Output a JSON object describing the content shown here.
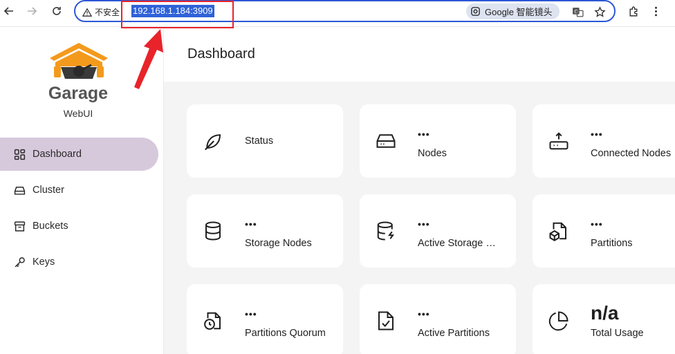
{
  "browser": {
    "security_label": "不安全",
    "url": "192.168.1.184:3909",
    "lens_label": "Google 智能镜头"
  },
  "sidebar": {
    "brand_title": "Garage",
    "brand_subtitle": "WebUI",
    "items": [
      {
        "label": "Dashboard",
        "active": true
      },
      {
        "label": "Cluster",
        "active": false
      },
      {
        "label": "Buckets",
        "active": false
      },
      {
        "label": "Keys",
        "active": false
      }
    ]
  },
  "main": {
    "title": "Dashboard",
    "cards": [
      {
        "label": "Status",
        "value": ""
      },
      {
        "label": "Nodes",
        "value": "•••"
      },
      {
        "label": "Connected Nodes",
        "value": "•••"
      },
      {
        "label": "Storage Nodes",
        "value": "•••"
      },
      {
        "label": "Active Storage Nodes",
        "value": "•••"
      },
      {
        "label": "Partitions",
        "value": "•••"
      },
      {
        "label": "Partitions Quorum",
        "value": "•••"
      },
      {
        "label": "Active Partitions",
        "value": "•••"
      },
      {
        "label": "Total Usage",
        "value": "n/a"
      }
    ]
  },
  "colors": {
    "accent_nav": "#d7c9dc",
    "omnibox_border": "#2b57d6",
    "annotation_red": "#e8232a",
    "logo_orange": "#f39a1c"
  }
}
